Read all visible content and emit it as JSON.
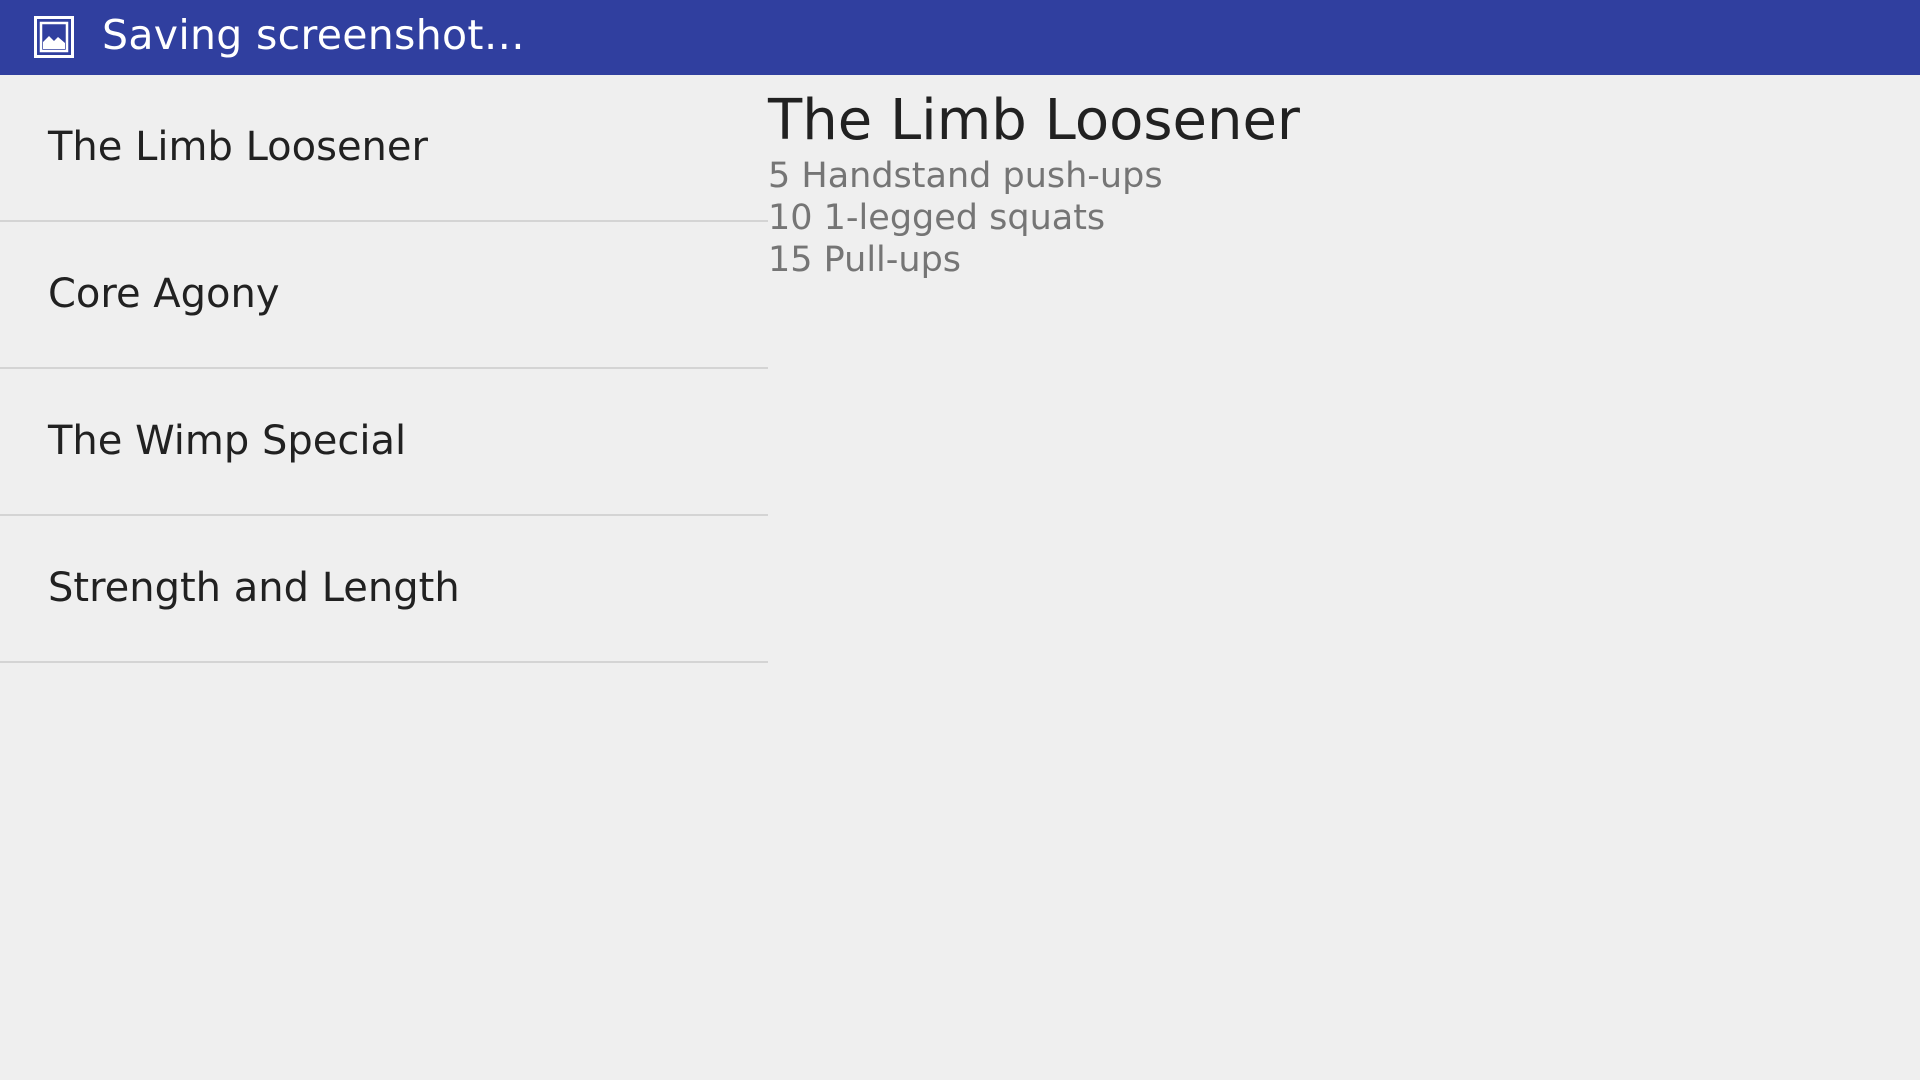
{
  "notification": {
    "icon": "screenshot-icon",
    "text": "Saving screenshot…"
  },
  "workouts": [
    {
      "name": "The Limb Loosener"
    },
    {
      "name": "Core Agony"
    },
    {
      "name": "The Wimp Special"
    },
    {
      "name": "Strength and Length"
    }
  ],
  "detail": {
    "title": "The Limb Loosener",
    "exercises": [
      "5 Handstand push-ups",
      "10 1-legged squats",
      "15 Pull-ups"
    ]
  },
  "colors": {
    "notification_bar": "#303f9f",
    "background": "#efefef",
    "primary_text": "#212121",
    "secondary_text": "#757575",
    "divider": "#d4d4d4"
  }
}
